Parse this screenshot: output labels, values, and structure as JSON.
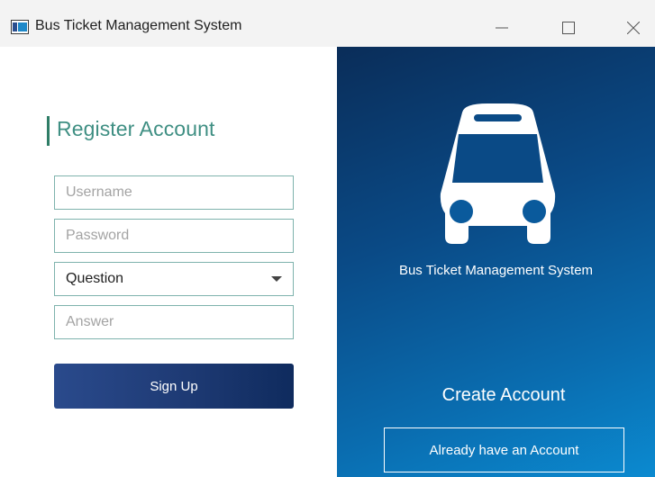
{
  "window": {
    "title": "Bus Ticket Management System"
  },
  "register": {
    "heading": "Register Account",
    "username_placeholder": "Username",
    "password_placeholder": "Password",
    "question_value": "Question",
    "answer_placeholder": "Answer",
    "signup_label": "Sign Up"
  },
  "brand": {
    "icon": "bus-icon",
    "system_name": "Bus Ticket Management System",
    "create_label": "Create Account",
    "login_link_label": "Already have an Account"
  },
  "colors": {
    "accent": "#3f8f83",
    "button": "#1e3a74",
    "panel_top": "#0a2d59",
    "panel_bottom": "#0b8ad0"
  }
}
